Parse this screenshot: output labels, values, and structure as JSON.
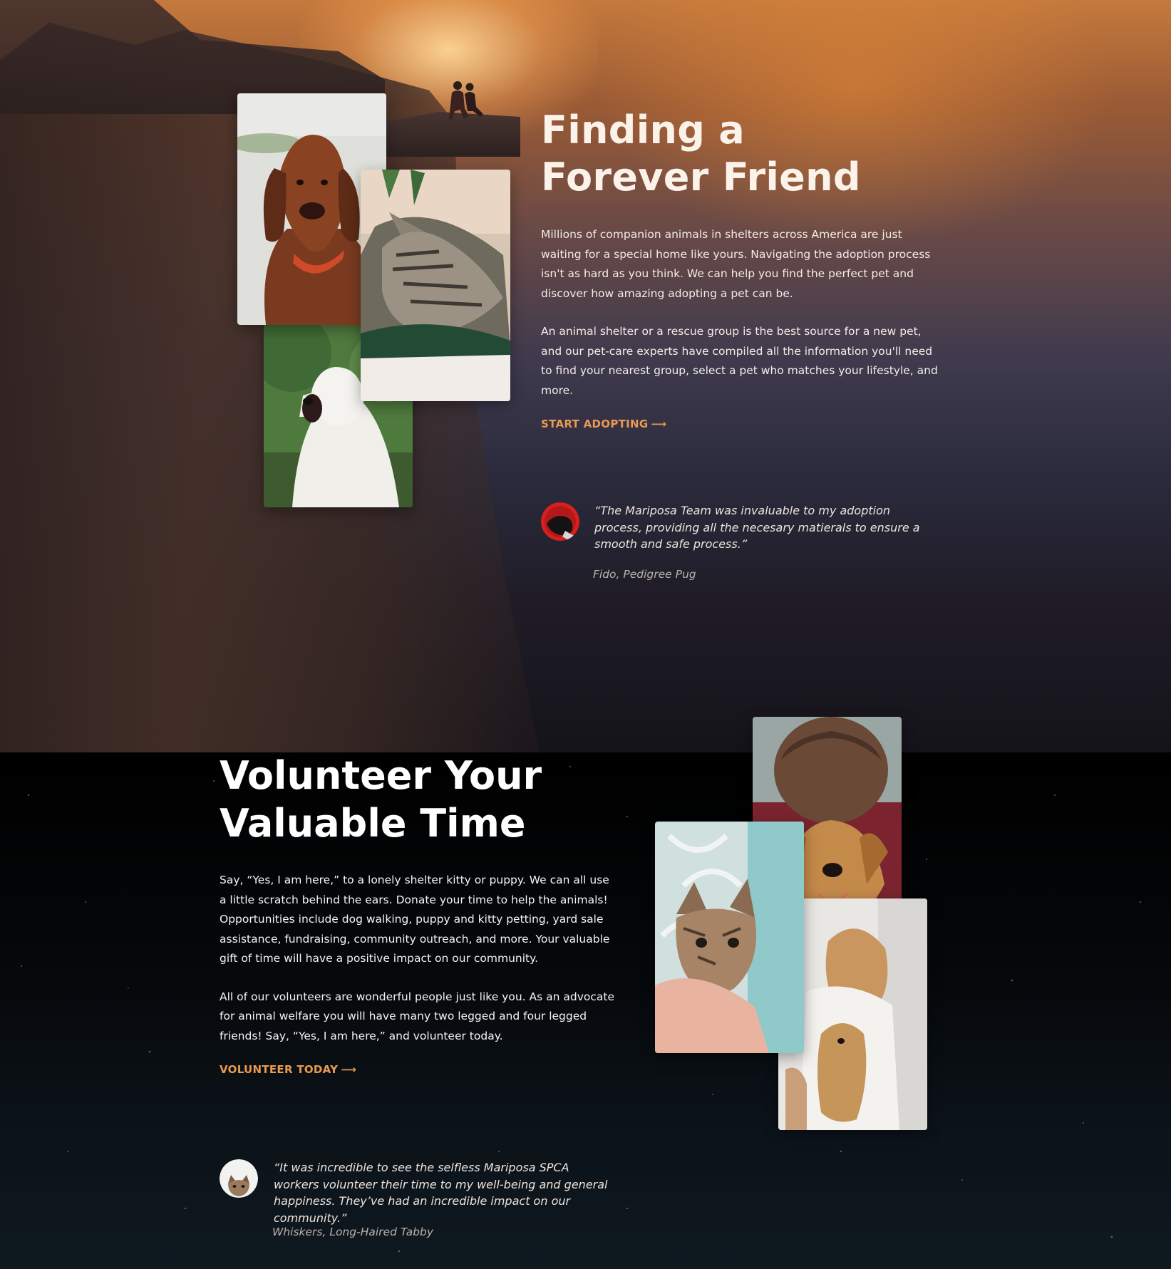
{
  "hero": {
    "title_line1": "Finding a",
    "title_line2": "Forever Friend",
    "paragraph1": "Millions of companion animals in shelters across America are just waiting for a special home like yours. Navigating the adoption process isn't as hard as you think. We can help you find the perfect pet and discover how amazing adopting a pet can be.",
    "paragraph2": "An animal shelter or a rescue group is the best source for a new pet, and our pet-care experts have compiled all the information you'll need to find your nearest group, select a pet who matches your lifestyle, and more.",
    "cta_label": "START ADOPTING",
    "cta_arrow": "⟶",
    "quote": "“The Mariposa Team was invaluable to my adoption process, providing all the necesary matierals to ensure a smooth and safe process.”",
    "quote_author": "Fido, Pedigree Pug",
    "accent_color": "#e89a52"
  },
  "volunteer": {
    "title_line1": "Volunteer Your",
    "title_line2": "Valuable Time",
    "paragraph1": "Say, “Yes, I am here,” to a lonely shelter kitty or puppy. We can all use a little scratch behind the ears. Donate your time to help the animals! Opportunities include dog walking, puppy and kitty petting, yard sale assistance, fundraising, community outreach, and more. Your valuable gift of time will have a positive impact on our community.",
    "paragraph2": "All of our volunteers are wonderful people just like you. As an advocate for animal welfare you will have many two legged and four legged friends! Say, “Yes, I am here,” and volunteer today.",
    "cta_label": "VOLUNTEER TODAY",
    "cta_arrow": "⟶",
    "quote": "“It was incredible to see the selfless Mariposa SPCA workers volunteer their time to my well-being and general happiness. They’ve had an incredible impact on our community.”",
    "quote_author": "Whiskers, Long-Haired Tabby"
  }
}
